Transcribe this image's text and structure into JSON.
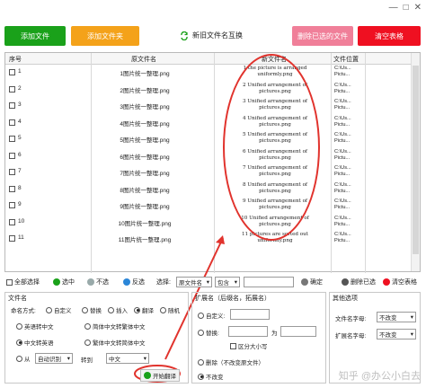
{
  "window": {
    "min_glyph": "—",
    "max_glyph": "□",
    "close_glyph": "✕"
  },
  "top_buttons": {
    "add_file": "添加文件",
    "add_folder": "添加文件夹",
    "swap_names": "新旧文件名互换",
    "delete_selected": "删除已选的文件",
    "clear_table": "清空表格"
  },
  "colors": {
    "green": "#1aa11a",
    "orange": "#f4a21a",
    "pink": "#f07f99",
    "red": "#ef1021",
    "annotation": "#e1332d"
  },
  "table": {
    "headers": {
      "idx": "序号",
      "orig": "原文件名",
      "new": "新文件名",
      "loc": "文件位置"
    },
    "rows": [
      {
        "idx": "1",
        "orig": "1图片统一整理.png",
        "new": "1 the picture is arranged uniformly.png",
        "loc": "C:\\Us... Pictu..."
      },
      {
        "idx": "2",
        "orig": "2图片统一整理.png",
        "new": "2 Unified arrangement of pictures.png",
        "loc": "C:\\Us... Pictu..."
      },
      {
        "idx": "3",
        "orig": "3图片统一整理.png",
        "new": "3 Unified arrangement of pictures.png",
        "loc": "C:\\Us... Pictu..."
      },
      {
        "idx": "4",
        "orig": "4图片统一整理.png",
        "new": "4 Unified arrangement of pictures.png",
        "loc": "C:\\Us... Pictu..."
      },
      {
        "idx": "5",
        "orig": "5图片统一整理.png",
        "new": "5 Unified arrangement of pictures.png",
        "loc": "C:\\Us... Pictu..."
      },
      {
        "idx": "6",
        "orig": "6图片统一整理.png",
        "new": "6 Unified arrangement of pictures.png",
        "loc": "C:\\Us... Pictu..."
      },
      {
        "idx": "7",
        "orig": "7图片统一整理.png",
        "new": "7 Unified arrangement of pictures.png",
        "loc": "C:\\Us... Pictu..."
      },
      {
        "idx": "8",
        "orig": "8图片统一整理.png",
        "new": "8 Unified arrangement of pictures.png",
        "loc": "C:\\Us... Pictu..."
      },
      {
        "idx": "9",
        "orig": "9图片统一整理.png",
        "new": "9 Unified arrangement of pictures.png",
        "loc": "C:\\Us... Pictu..."
      },
      {
        "idx": "10",
        "orig": "10图片统一整理.png",
        "new": "10 Unified arrangement of pictures.png",
        "loc": "C:\\Us... Pictu..."
      },
      {
        "idx": "11",
        "orig": "11图片统一整理.png",
        "new": "11 pictures are sorted out uniformly.png",
        "loc": "C:\\Us... Pictu..."
      }
    ]
  },
  "toolbar": {
    "select_all": "全部选择",
    "check": "选中",
    "uncheck": "不选",
    "invert": "反选",
    "select_label": "选择:",
    "field_value": "原文件名",
    "op_value": "包含",
    "confirm": "确定",
    "delete_selected": "删除已选",
    "clear_table": "清空表格"
  },
  "filename_panel": {
    "title": "文件名",
    "naming_label": "命名方式:",
    "opt_custom": "自定义",
    "opt_replace": "替换",
    "opt_insert": "插入",
    "opt_translate": "翻译",
    "opt_random": "随机",
    "t_en_zh": "英语转中文",
    "t_s2t": "简体中文转繁体中文",
    "t_zh_en": "中文转英语",
    "t_t2s": "繁体中文转简体中文",
    "from_label": "从",
    "from_value": "自动识别",
    "to_label": "转到",
    "to_value": "中文",
    "start_button": "开始翻译"
  },
  "ext_panel": {
    "title": "扩展名（后缀名，拓展名）",
    "opt_custom": "自定义:",
    "opt_replace": "替换:",
    "replace_as": "为",
    "case_label": "区分大小写",
    "opt_delete": "删除（不改变原文件）",
    "opt_keep": "不改变"
  },
  "other_panel": {
    "title": "其他选项",
    "name_case_label": "文件名字母:",
    "name_case_value": "不改变",
    "ext_case_label": "扩展名字母:",
    "ext_case_value": "不改变"
  },
  "watermark": "知乎 @办公小白去"
}
